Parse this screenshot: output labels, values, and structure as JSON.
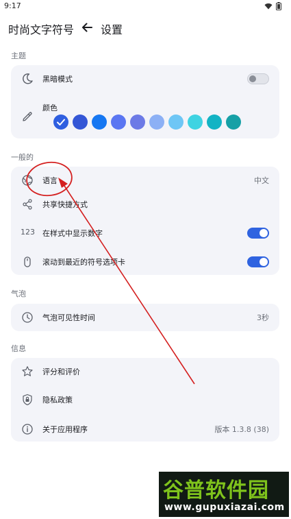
{
  "status_bar": {
    "time": "9:17",
    "icons": [
      "wifi-icon",
      "battery-icon"
    ]
  },
  "app_bar": {
    "app_title": "时尚文字符号",
    "back_icon": "arrow-left-icon",
    "page_title": "设置"
  },
  "sections": {
    "theme": {
      "label": "主题",
      "dark_mode": {
        "label": "黑暗模式",
        "icon": "moon-icon",
        "enabled": false
      },
      "color": {
        "label": "颜色",
        "icon": "eyedropper-icon",
        "selected_index": 0,
        "swatches": [
          "#2f5fe0",
          "#3356d6",
          "#1677f2",
          "#5a76f2",
          "#6c7ae6",
          "#8cb0f5",
          "#6ec6f5",
          "#3fd3e2",
          "#13b3c4",
          "#16a0a6"
        ]
      }
    },
    "general": {
      "label": "一般的",
      "language": {
        "label": "语言",
        "icon": "globe-icon",
        "value": "中文"
      },
      "share": {
        "label": "共享快捷方式",
        "icon": "share-icon"
      },
      "show_numbers": {
        "label": "在样式中显示数字",
        "icon_text": "123",
        "enabled": true
      },
      "scroll_recent": {
        "label": "滚动到最近的符号选项卡",
        "icon": "mouse-icon",
        "enabled": true
      }
    },
    "bubble": {
      "label": "气泡",
      "visibility_time": {
        "label": "气泡可见性时间",
        "icon": "clock-icon",
        "value": "3秒"
      }
    },
    "info": {
      "label": "信息",
      "rate": {
        "label": "评分和评价",
        "icon": "star-icon"
      },
      "privacy": {
        "label": "隐私政策",
        "icon": "shield-lock-icon"
      },
      "about": {
        "label": "关于应用程序",
        "icon": "info-icon",
        "value": "版本 1.3.8 (38)"
      }
    }
  },
  "colors": {
    "accent": "#2f63e0",
    "card_background": "#f3f4f9",
    "annotation": "#d42020"
  },
  "watermark": {
    "brand": "谷普软件园",
    "url": "www.gupuxiazai.com"
  }
}
